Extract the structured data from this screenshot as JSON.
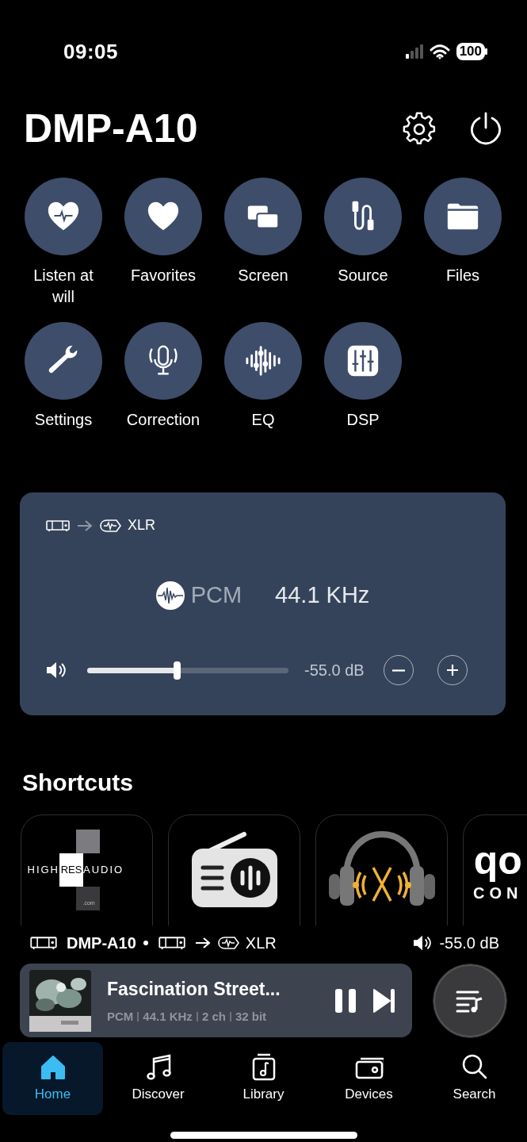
{
  "status_bar": {
    "time": "09:05",
    "battery": "100"
  },
  "header": {
    "title": "DMP-A10"
  },
  "actions": [
    {
      "label": "Listen at will"
    },
    {
      "label": "Favorites"
    },
    {
      "label": "Screen"
    },
    {
      "label": "Source"
    },
    {
      "label": "Files"
    },
    {
      "label": "Settings"
    },
    {
      "label": "Correction"
    },
    {
      "label": "EQ"
    },
    {
      "label": "DSP"
    }
  ],
  "output_card": {
    "output": "XLR",
    "format": "PCM",
    "rate": "44.1 KHz",
    "volume": {
      "level": 0.445,
      "reading": "-55.0 dB"
    }
  },
  "shortcuts": {
    "title": "Shortcuts",
    "items": [
      {
        "kind": "highres",
        "parts": [
          "HIGH",
          "RES",
          "AUDIO"
        ],
        "suffix": ".com"
      },
      {
        "kind": "radio"
      },
      {
        "kind": "headphones"
      },
      {
        "kind": "qobuz",
        "text": "qo",
        "sub": "CON"
      }
    ]
  },
  "device_line": {
    "device": "DMP-A10",
    "output": "XLR",
    "volume": "-55.0 dB"
  },
  "now_playing": {
    "title": "Fascination Street...",
    "details": [
      "PCM",
      "44.1 KHz",
      "2 ch",
      "32 bit"
    ],
    "playing": true
  },
  "tabs": [
    {
      "label": "Home",
      "selected": true
    },
    {
      "label": "Discover",
      "selected": false
    },
    {
      "label": "Library",
      "selected": false
    },
    {
      "label": "Devices",
      "selected": false
    },
    {
      "label": "Search",
      "selected": false
    }
  ]
}
